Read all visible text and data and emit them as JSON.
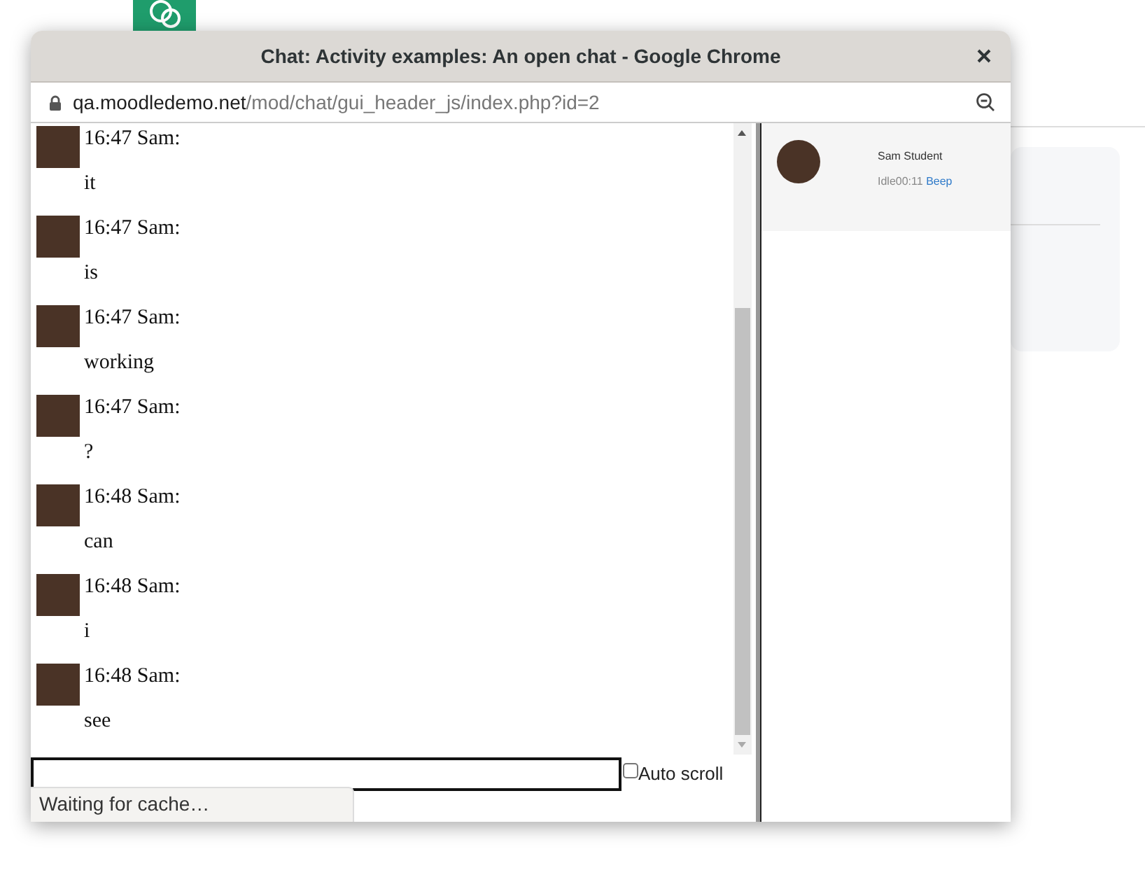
{
  "window": {
    "title": "Chat: Activity examples: An open chat - Google Chrome",
    "url_host": "qa.moodledemo.net",
    "url_path": "/mod/chat/gui_header_js/index.php?id=2"
  },
  "messages": [
    {
      "header": "16:47 Sam:",
      "text": "it"
    },
    {
      "header": "16:47 Sam:",
      "text": "is"
    },
    {
      "header": "16:47 Sam:",
      "text": "working"
    },
    {
      "header": "16:47 Sam:",
      "text": "?"
    },
    {
      "header": "16:48 Sam:",
      "text": "can"
    },
    {
      "header": "16:48 Sam:",
      "text": "i"
    },
    {
      "header": "16:48 Sam:",
      "text": "see"
    }
  ],
  "auto_scroll": {
    "label": "Auto scroll",
    "checked": false
  },
  "users": [
    {
      "name": "Sam Student",
      "idle": "Idle00:11",
      "beep": "Beep"
    }
  ],
  "status_bubble": "Waiting for cache…"
}
